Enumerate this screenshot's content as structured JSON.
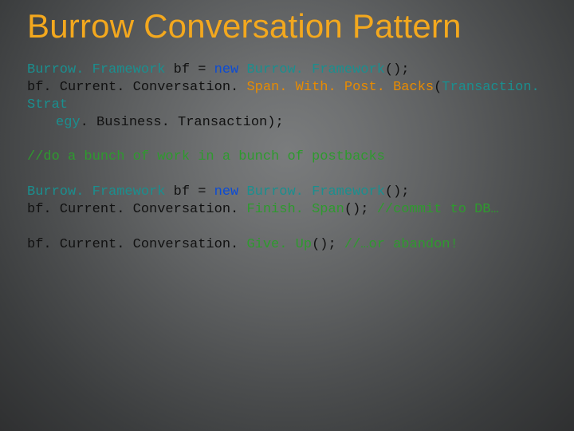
{
  "title": "Burrow Conversation Pattern",
  "code": {
    "l1a": "Burrow. Framework",
    "l1b": " bf = ",
    "l1c": "new",
    "l1d": " Burrow. Framework",
    "l1e": "();",
    "l2a": "bf. Current. Conversation. ",
    "l2b": "Span. With. Post. Backs",
    "l2c": "(",
    "l2d": "Transaction. Strat",
    "l3a": "egy",
    "l3b": ". Business. Transaction);",
    "c1": "//do a bunch of work in a bunch of postbacks",
    "l4a": "Burrow. Framework",
    "l4b": " bf = ",
    "l4c": "new",
    "l4d": " Burrow. Framework",
    "l4e": "();",
    "l5a": "bf. Current. Conversation. ",
    "l5b": "Finish. Span",
    "l5c": "(); ",
    "l5d": "//commit to DB…",
    "l6a": "bf. Current. Conversation. ",
    "l6b": "Give. Up",
    "l6c": "(); ",
    "l6d": "//…or abandon!"
  },
  "colors": {
    "title": "#f3a81e",
    "blue": "#0a4bd6",
    "teal": "#1a8f8f",
    "orange": "#e88b00",
    "green": "#2e9a2e"
  }
}
